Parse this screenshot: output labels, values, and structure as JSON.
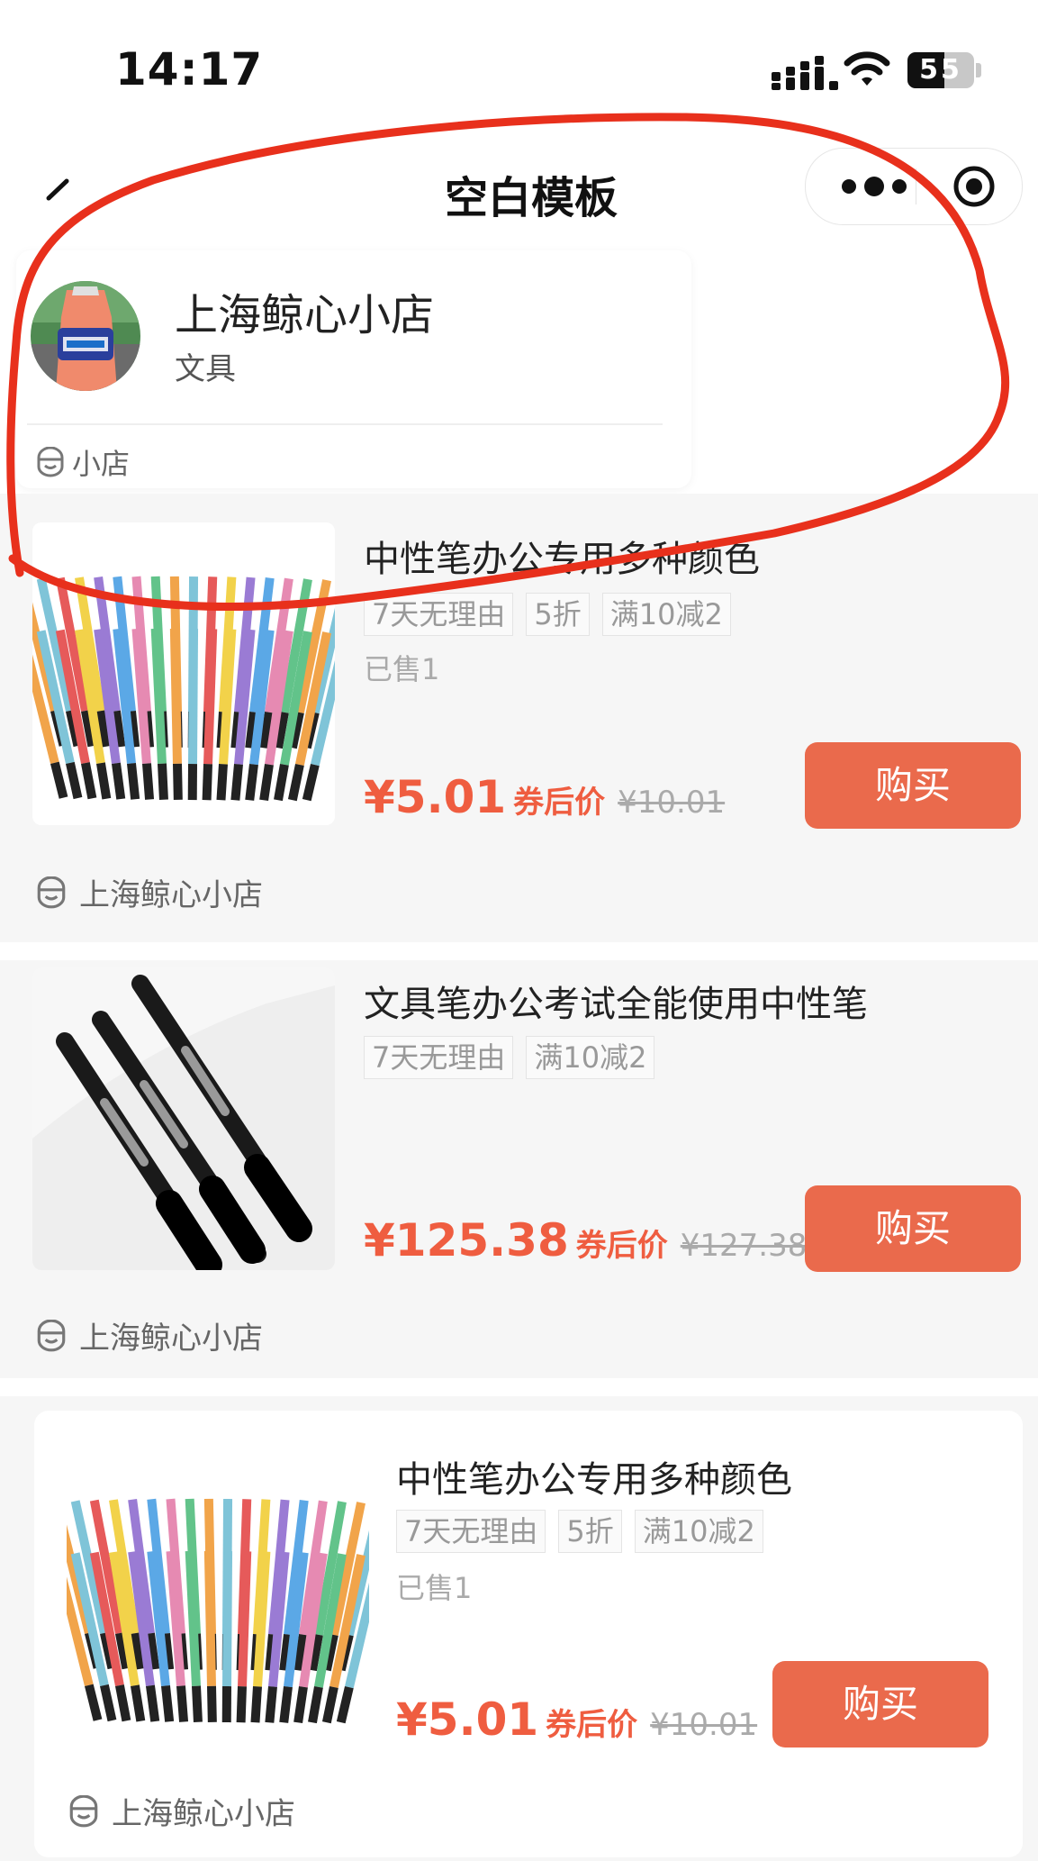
{
  "status_bar": {
    "time": "14:17",
    "battery_level": "55",
    "battery_percent": 55
  },
  "nav": {
    "title": "空白模板",
    "back_icon": "chevron-left-icon",
    "more_icon": "more-dots-icon",
    "close_icon": "target-icon"
  },
  "shop": {
    "name": "上海鲸心小店",
    "category": "文具",
    "link_label": "小店",
    "store_icon": "shop-icon"
  },
  "products": [
    {
      "title": "中性笔办公专用多种颜色",
      "tags": [
        "7天无理由",
        "5折",
        "满10减2"
      ],
      "sold": "已售1",
      "price": "¥5.01",
      "coupon_label": "券后价",
      "original_price": "¥10.01",
      "buy_label": "购买",
      "store_name": "上海鲸心小店"
    },
    {
      "title": "文具笔办公考试全能使用中性笔",
      "tags": [
        "7天无理由",
        "满10减2"
      ],
      "price": "¥125.38",
      "coupon_label": "券后价",
      "original_price": "¥127.38",
      "buy_label": "购买",
      "store_name": "上海鲸心小店"
    },
    {
      "title": "中性笔办公专用多种颜色",
      "tags": [
        "7天无理由",
        "5折",
        "满10减2"
      ],
      "sold": "已售1",
      "price": "¥5.01",
      "coupon_label": "券后价",
      "original_price": "¥10.01",
      "buy_label": "购买",
      "store_name": "上海鲸心小店"
    }
  ],
  "colors": {
    "accent": "#ef5d40",
    "button": "#ea6a4c",
    "annotation": "#e8301c"
  }
}
